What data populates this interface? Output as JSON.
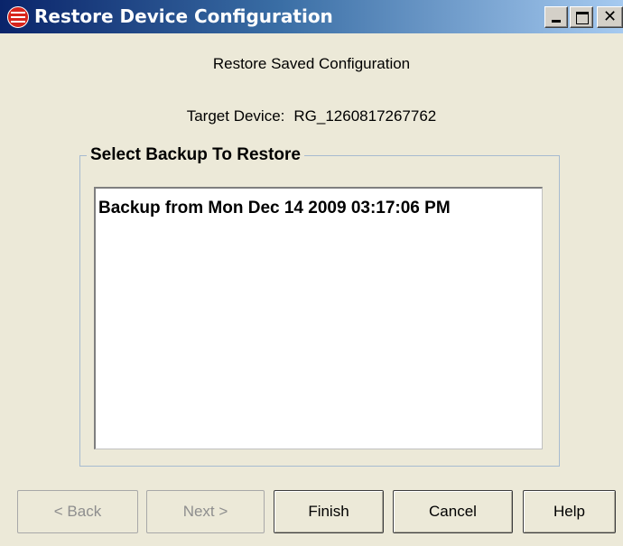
{
  "window": {
    "title": "Restore Device Configuration",
    "icon": "red-globe-icon",
    "controls": {
      "minimize": "minimize-icon",
      "maximize": "maximize-icon",
      "close_glyph": "✕"
    }
  },
  "header": {
    "subtitle": "Restore Saved Configuration",
    "target_label": "Target Device:",
    "target_value": "RG_1260817267762"
  },
  "group": {
    "legend": "Select Backup To Restore",
    "items": [
      "Backup from Mon Dec 14 2009 03:17:06 PM"
    ]
  },
  "buttons": {
    "back": "< Back",
    "next": "Next >",
    "finish": "Finish",
    "cancel": "Cancel",
    "help": "Help"
  },
  "button_states": {
    "back": "disabled",
    "next": "disabled",
    "finish": "enabled",
    "cancel": "enabled",
    "help": "enabled"
  },
  "colors": {
    "title_bar_start": "#0a246a",
    "title_bar_end": "#a6caf0",
    "dialog_background": "#ece9d8",
    "icon_red": "#d8241c"
  }
}
